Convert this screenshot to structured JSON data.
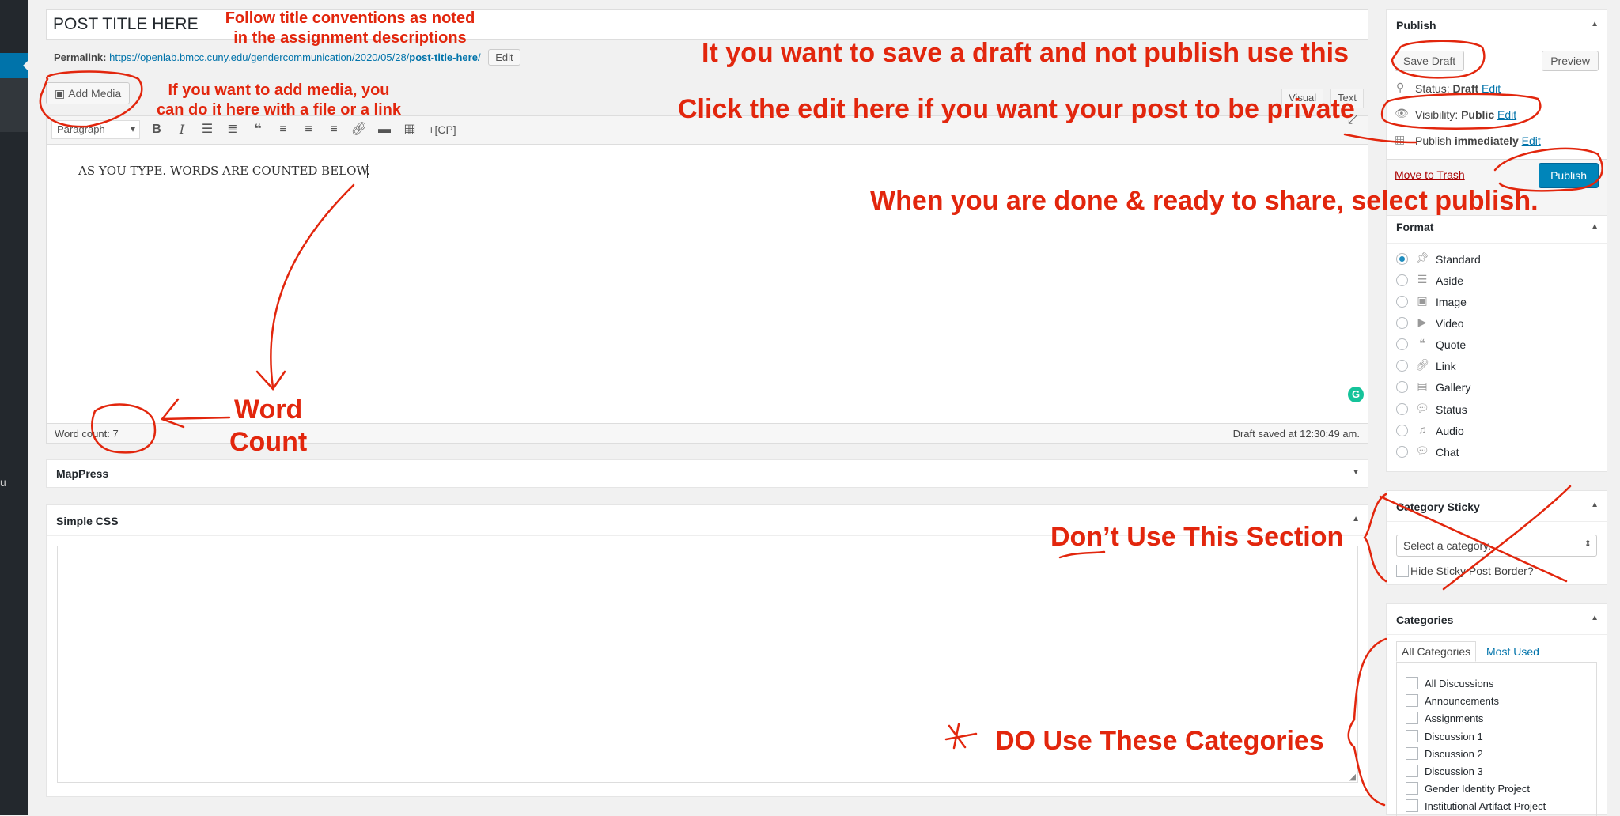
{
  "sidebar": {
    "collapse_label": "u"
  },
  "post": {
    "title": "POST TITLE HERE",
    "permalink_label": "Permalink:",
    "permalink_base": "https://openlab.bmcc.cuny.edu/gendercommunication/2020/05/28/",
    "permalink_slug": "post-title-here",
    "permalink_trailing": "/",
    "permalink_edit": "Edit",
    "body_text": "AS YOU TYPE. WORDS ARE COUNTED BELOW.",
    "word_count": "Word count: 7",
    "draft_saved": "Draft saved at 12:30:49 am."
  },
  "editor": {
    "add_media": "Add Media",
    "tab_visual": "Visual",
    "tab_text": "Text",
    "format_select": "Paragraph",
    "cp_button": "+[CP]",
    "grammarly_icon": "G"
  },
  "mappress": {
    "title": "MapPress",
    "toggle": "▼"
  },
  "simple_css": {
    "title": "Simple CSS",
    "toggle": "▲"
  },
  "publish": {
    "title": "Publish",
    "toggle": "▲",
    "save_draft": "Save Draft",
    "preview": "Preview",
    "status_label": "Status:",
    "status_value": "Draft",
    "visibility_label": "Visibility:",
    "visibility_value": "Public",
    "schedule_label": "Publish",
    "schedule_value": "immediately",
    "edit": "Edit",
    "move_to_trash": "Move to Trash",
    "publish_button": "Publish",
    "accent_color": "#0085ba"
  },
  "format": {
    "title": "Format",
    "toggle": "▲",
    "selected": "Standard",
    "options": [
      "Standard",
      "Aside",
      "Image",
      "Video",
      "Quote",
      "Link",
      "Gallery",
      "Status",
      "Audio",
      "Chat"
    ]
  },
  "category_sticky": {
    "title": "Category Sticky",
    "toggle": "▲",
    "select_placeholder": "Select a category.",
    "hide_border_label": "Hide Sticky Post Border?"
  },
  "categories": {
    "title": "Categories",
    "toggle": "▲",
    "tab_all": "All Categories",
    "tab_most_used": "Most Used",
    "items": [
      "All Discussions",
      "Announcements",
      "Assignments",
      "Discussion 1",
      "Discussion 2",
      "Discussion 3",
      "Gender Identity Project",
      "Institutional Artifact Project"
    ]
  },
  "annotations": {
    "title_note_1": "Follow title conventions as noted",
    "title_note_2": "in the assignment descriptions",
    "media_note_1": "If you want to add media, you",
    "media_note_2": "can do it here with a file or a link",
    "draft_note": "It you want to save a draft and not publish use this",
    "private_note": "Click the edit here if you want your post to be private",
    "publish_note": "When you are done & ready to share, select publish.",
    "word_note_1": "Word",
    "word_note_2": "Count",
    "dont_use_note": "Don’t Use This Section",
    "do_use_note": "DO Use These Categories",
    "star": "✱",
    "ink_color": "#e2260d"
  }
}
